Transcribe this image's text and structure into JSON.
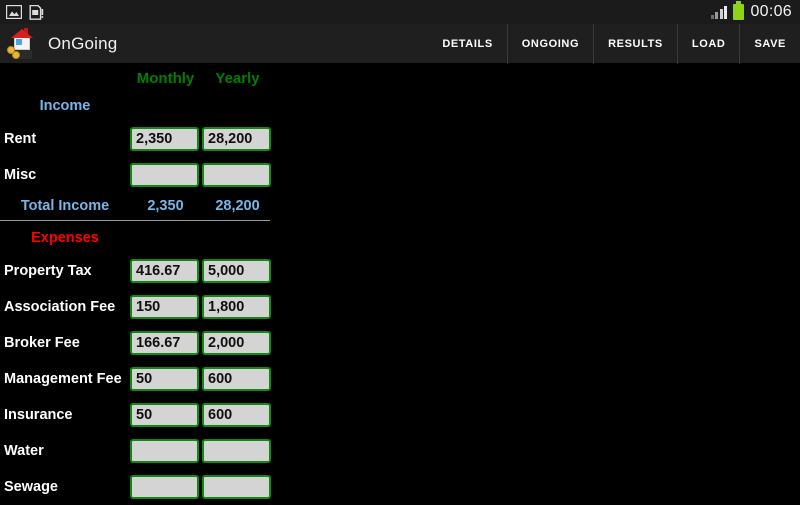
{
  "status_bar": {
    "notifications": [
      "image-icon",
      "sd-card-warning-icon"
    ],
    "signal_icon": "signal-bars-icon",
    "battery_icon": "battery-icon",
    "clock": "00:06"
  },
  "action_bar": {
    "app_icon": "house-with-coins-icon",
    "title": "OnGoing",
    "menu": [
      {
        "label": "DETAILS"
      },
      {
        "label": "ONGOING"
      },
      {
        "label": "RESULTS"
      },
      {
        "label": "LOAD"
      },
      {
        "label": "SAVE"
      }
    ]
  },
  "table": {
    "columns": [
      {
        "label": "Monthly"
      },
      {
        "label": "Yearly"
      }
    ],
    "income_section": {
      "label": "Income"
    },
    "income_rows": [
      {
        "label": "Rent",
        "monthly": "2,350",
        "yearly": "28,200"
      },
      {
        "label": "Misc",
        "monthly": "",
        "yearly": ""
      }
    ],
    "total_income": {
      "label": "Total Income",
      "monthly": "2,350",
      "yearly": "28,200"
    },
    "expenses_section": {
      "label": "Expenses"
    },
    "expense_rows": [
      {
        "label": "Property Tax",
        "monthly": "416.67",
        "yearly": "5,000"
      },
      {
        "label": "Association Fee",
        "monthly": "150",
        "yearly": "1,800"
      },
      {
        "label": "Broker Fee",
        "monthly": "166.67",
        "yearly": "2,000"
      },
      {
        "label": "Management Fee",
        "monthly": "50",
        "yearly": "600"
      },
      {
        "label": "Insurance",
        "monthly": "50",
        "yearly": "600"
      },
      {
        "label": "Water",
        "monthly": "",
        "yearly": ""
      },
      {
        "label": "Sewage",
        "monthly": "",
        "yearly": ""
      }
    ]
  },
  "colors": {
    "header_green": "#008000",
    "income_blue": "#76b6e8",
    "expenses_red": "#ff0000",
    "field_border": "#118811",
    "field_bg": "#d4d4d4",
    "background": "#000000",
    "action_bar": "#1f1f1f",
    "battery_green": "#8fd318"
  }
}
